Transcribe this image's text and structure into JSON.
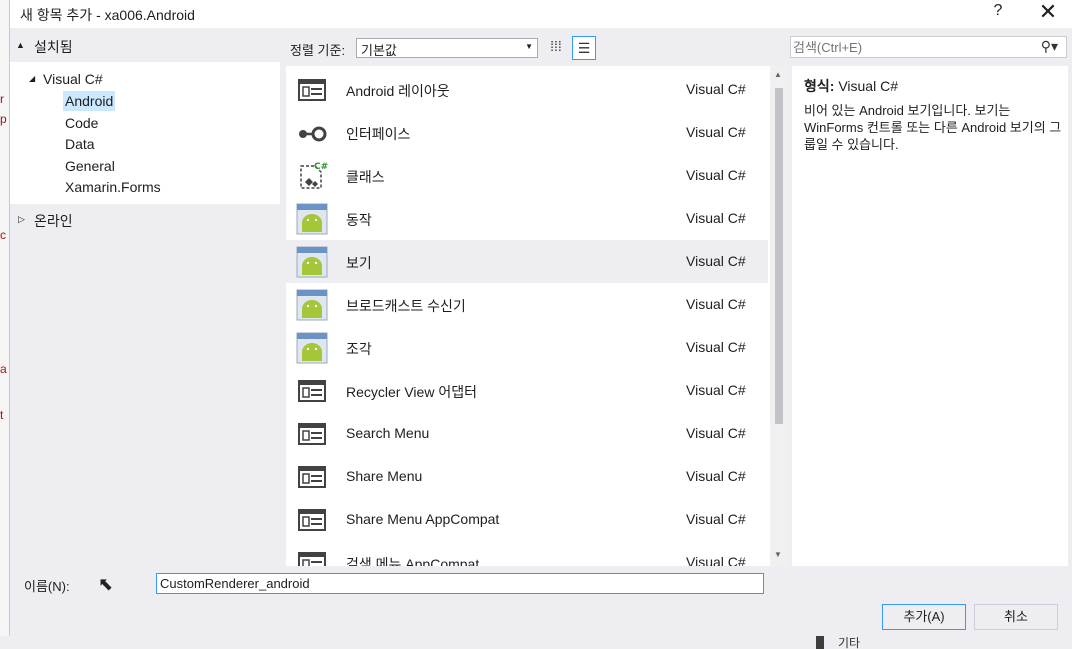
{
  "window": {
    "title": "새 항목 추가 - xa006.Android",
    "help_label": "?",
    "close_label": "✕"
  },
  "left": {
    "installed_label": "설치됨",
    "tree": [
      {
        "label": "Visual C#"
      },
      {
        "label": "Android",
        "selected": true
      },
      {
        "label": "Code"
      },
      {
        "label": "Data"
      },
      {
        "label": "General"
      },
      {
        "label": "Xamarin.Forms"
      }
    ],
    "online_label": "온라인"
  },
  "sort": {
    "label": "정렬 기준:",
    "value": "기본값"
  },
  "search": {
    "placeholder": "검색(Ctrl+E)"
  },
  "items": [
    {
      "name": "Android 레이아웃",
      "lang": "Visual C#",
      "icon": "layout-icon"
    },
    {
      "name": "인터페이스",
      "lang": "Visual C#",
      "icon": "interface-icon"
    },
    {
      "name": "클래스",
      "lang": "Visual C#",
      "icon": "class-icon"
    },
    {
      "name": "동작",
      "lang": "Visual C#",
      "icon": "android-icon"
    },
    {
      "name": "보기",
      "lang": "Visual C#",
      "icon": "android-icon",
      "selected": true
    },
    {
      "name": "브로드캐스트 수신기",
      "lang": "Visual C#",
      "icon": "android-icon"
    },
    {
      "name": "조각",
      "lang": "Visual C#",
      "icon": "android-icon"
    },
    {
      "name": "Recycler View 어댑터",
      "lang": "Visual C#",
      "icon": "layout-icon"
    },
    {
      "name": "Search Menu",
      "lang": "Visual C#",
      "icon": "layout-icon"
    },
    {
      "name": "Share Menu",
      "lang": "Visual C#",
      "icon": "layout-icon"
    },
    {
      "name": "Share Menu AppCompat",
      "lang": "Visual C#",
      "icon": "layout-icon"
    },
    {
      "name": "검색 메뉴 AppCompat",
      "lang": "Visual C#",
      "icon": "layout-icon"
    }
  ],
  "details": {
    "type_key": "형식:",
    "type_value": "Visual C#",
    "description": "비어 있는 Android 보기입니다. 보기는 WinForms 컨트롤 또는 다른 Android 보기의 그룹일 수 있습니다."
  },
  "footer": {
    "name_label": "이름(N):",
    "name_value": "CustomRenderer_android",
    "add_label": "추가(A)",
    "cancel_label": "취소"
  },
  "background": {
    "status_text": "기타"
  },
  "colors": {
    "accent": "#3399ff",
    "selection": "#cce8ff",
    "android_green": "#a4c639"
  }
}
